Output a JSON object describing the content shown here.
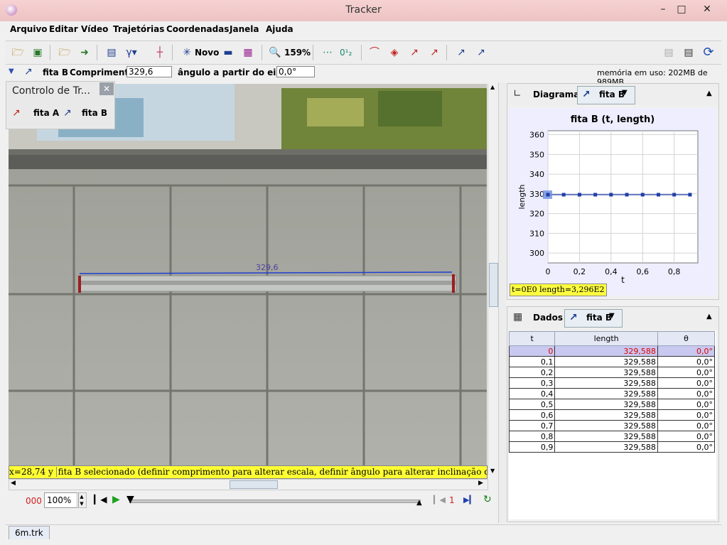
{
  "window": {
    "title": "Tracker"
  },
  "menu": [
    "Arquivo",
    "Editar",
    "Vídeo",
    "Trajetórias",
    "Coordenadas",
    "Janela",
    "Ajuda"
  ],
  "toolbar": {
    "novo_label": "Novo",
    "zoom_label": "159%",
    "sub_label": "0¹₂"
  },
  "propbar": {
    "track_name": "fita B",
    "length_label": "Comprimento",
    "length_value": "329,6",
    "angle_label": "ângulo a partir do eixo X",
    "angle_value": "0,0°",
    "memory": "memória em uso: 202MB de 989MB"
  },
  "popup": {
    "title": "Controlo de Tr...",
    "track_a": "fita A",
    "track_b": "fita B"
  },
  "video": {
    "measure_label": "329,6"
  },
  "status": {
    "coords": "x=28,74  y",
    "message": "fita B selecionado (definir comprimento para alterar escala, definir ângulo para alterar inclinação do eixo x)"
  },
  "player": {
    "frame": "000",
    "zoom": "100%",
    "step": "1"
  },
  "plot_panel": {
    "label": "Diagrama",
    "track": "fita B"
  },
  "data_panel": {
    "label": "Dados",
    "track": "fita B"
  },
  "chart_data": {
    "type": "scatter",
    "title": "fita B (t, length)",
    "xlabel": "t",
    "ylabel": "length",
    "xlim": [
      0,
      0.95
    ],
    "ylim": [
      295,
      362
    ],
    "xticks": [
      "0",
      "0,2",
      "0,4",
      "0,6",
      "0,8"
    ],
    "xtick_values": [
      0,
      0.2,
      0.4,
      0.6,
      0.8
    ],
    "yticks": [
      "300",
      "310",
      "320",
      "330",
      "340",
      "350",
      "360"
    ],
    "ytick_values": [
      300,
      310,
      320,
      330,
      340,
      350,
      360
    ],
    "x": [
      0,
      0.1,
      0.2,
      0.3,
      0.4,
      0.5,
      0.6,
      0.7,
      0.8,
      0.9
    ],
    "y": [
      329.588,
      329.588,
      329.588,
      329.588,
      329.588,
      329.588,
      329.588,
      329.588,
      329.588,
      329.588
    ],
    "readout": "t=0E0  length=3,296E2",
    "grid": true,
    "colors": {
      "line": "#1f3fa8",
      "point": "#1f3fa8",
      "selected": "#6f8fe0"
    }
  },
  "table": {
    "headers": [
      "t",
      "length",
      "θ"
    ],
    "rows": [
      [
        "0",
        "329,588",
        "0,0°"
      ],
      [
        "0,1",
        "329,588",
        "0,0°"
      ],
      [
        "0,2",
        "329,588",
        "0,0°"
      ],
      [
        "0,3",
        "329,588",
        "0,0°"
      ],
      [
        "0,4",
        "329,588",
        "0,0°"
      ],
      [
        "0,5",
        "329,588",
        "0,0°"
      ],
      [
        "0,6",
        "329,588",
        "0,0°"
      ],
      [
        "0,7",
        "329,588",
        "0,0°"
      ],
      [
        "0,8",
        "329,588",
        "0,0°"
      ],
      [
        "0,9",
        "329,588",
        "0,0°"
      ]
    ]
  },
  "footer": {
    "tab": "6m.trk"
  }
}
